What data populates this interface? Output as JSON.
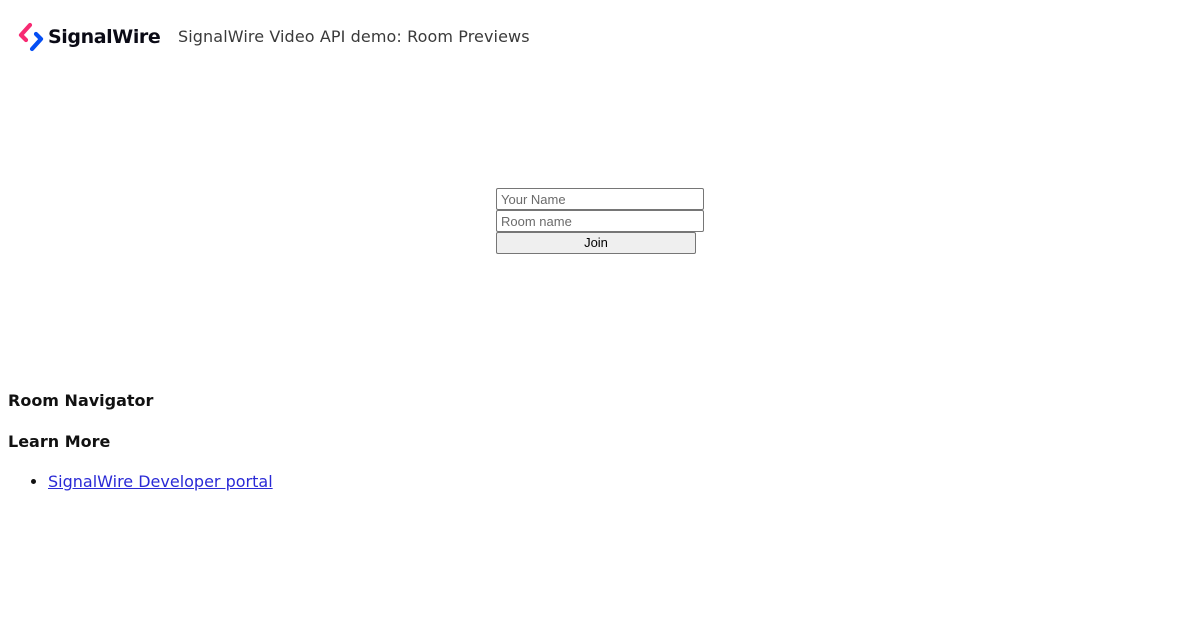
{
  "header": {
    "logo_text": "SignalWire",
    "app_title": "SignalWire Video API demo: Room Previews",
    "logo_colors": {
      "blue": "#044EF4",
      "pink": "#F72A72"
    }
  },
  "join_form": {
    "name_placeholder": "Your Name",
    "name_value": "",
    "room_placeholder": "Room name",
    "room_value": "",
    "join_label": "Join"
  },
  "sections": {
    "room_navigator_heading": "Room Navigator",
    "learn_more_heading": "Learn More"
  },
  "learn_more_links": [
    {
      "label": "SignalWire Developer portal"
    }
  ],
  "colors": {
    "link": "#2a2ad6",
    "button_bg": "#efefef",
    "input_border": "#767676"
  }
}
